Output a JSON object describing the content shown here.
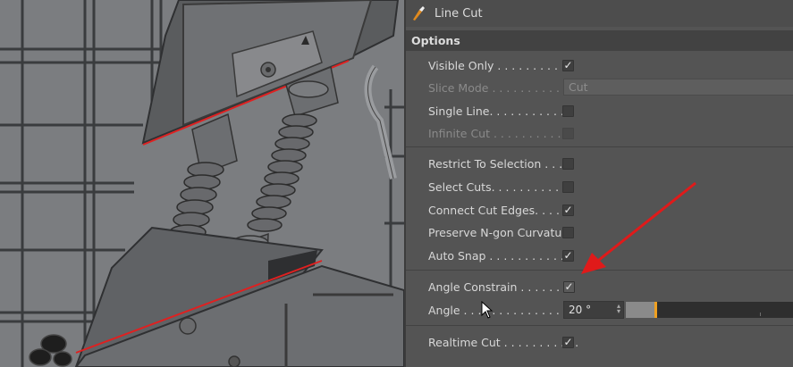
{
  "tool": {
    "title": "Line Cut",
    "icon": "knife-icon"
  },
  "options": {
    "header": "Options",
    "visible_only": {
      "label": "Visible Only . . . . . . . . . . .",
      "checked": true
    },
    "slice_mode": {
      "label": "Slice Mode . . . . . . . . . . . .",
      "value": "Cut"
    },
    "single_line": {
      "label": "Single Line. . . . . . . . . . . .",
      "checked": false
    },
    "infinite_cut": {
      "label": "Infinite Cut . . . . . . . . . . .",
      "checked": false
    },
    "restrict_to_selection": {
      "label": "Restrict To Selection . . . .",
      "checked": false
    },
    "select_cuts": {
      "label": "Select Cuts. . . . . . . . . . . .",
      "checked": false
    },
    "connect_cut_edges": {
      "label": "Connect Cut Edges. . . . . .",
      "checked": true
    },
    "preserve_ngon": {
      "label": "Preserve N-gon Curvature",
      "checked": false
    },
    "auto_snap": {
      "label": "Auto Snap . . . . . . . . . . . .",
      "checked": true
    },
    "angle_constrain": {
      "label": "Angle Constrain . . . . . . . .",
      "checked": true
    },
    "angle": {
      "label": "Angle . . . . . . . . . . . . . . . . .",
      "value": "20 °",
      "slider_fraction": 0.17
    },
    "realtime_cut": {
      "label": "Realtime Cut . . . . . . . . . . .",
      "checked": true
    }
  },
  "colors": {
    "panel_bg": "#545454",
    "header_bg": "#424242",
    "cut_line": "#e02020",
    "slider_handle": "#f0a020",
    "annotation_arrow": "#e01a1a"
  },
  "check_glyph": "✓"
}
